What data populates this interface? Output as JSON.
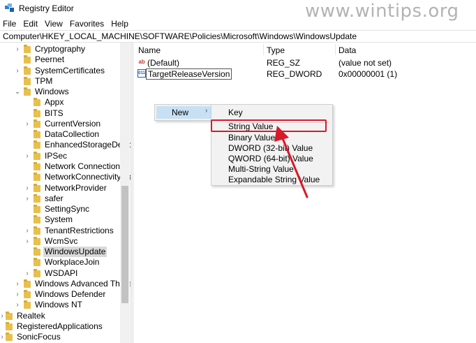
{
  "window": {
    "title": "Registry Editor"
  },
  "watermark": "www.wintips.org",
  "menu": [
    "File",
    "Edit",
    "View",
    "Favorites",
    "Help"
  ],
  "address": "Computer\\HKEY_LOCAL_MACHINE\\SOFTWARE\\Policies\\Microsoft\\Windows\\WindowsUpdate",
  "tree": [
    {
      "label": "Cryptography",
      "arrow": "›"
    },
    {
      "label": "Peernet",
      "arrow": ""
    },
    {
      "label": "SystemCertificates",
      "arrow": "›"
    },
    {
      "label": "TPM",
      "arrow": ""
    },
    {
      "label": "Windows",
      "arrow": "⌄"
    },
    {
      "label": "Appx",
      "arrow": ""
    },
    {
      "label": "BITS",
      "arrow": ""
    },
    {
      "label": "CurrentVersion",
      "arrow": "›"
    },
    {
      "label": "DataCollection",
      "arrow": ""
    },
    {
      "label": "EnhancedStorageDevic",
      "arrow": ""
    },
    {
      "label": "IPSec",
      "arrow": "›"
    },
    {
      "label": "Network Connections",
      "arrow": ""
    },
    {
      "label": "NetworkConnectivitySta",
      "arrow": ""
    },
    {
      "label": "NetworkProvider",
      "arrow": "›"
    },
    {
      "label": "safer",
      "arrow": "›"
    },
    {
      "label": "SettingSync",
      "arrow": ""
    },
    {
      "label": "System",
      "arrow": ""
    },
    {
      "label": "TenantRestrictions",
      "arrow": "›"
    },
    {
      "label": "WcmSvc",
      "arrow": "›"
    },
    {
      "label": "WindowsUpdate",
      "arrow": ""
    },
    {
      "label": "WorkplaceJoin",
      "arrow": ""
    },
    {
      "label": "WSDAPI",
      "arrow": "›"
    },
    {
      "label": "Windows Advanced Threa",
      "arrow": "›"
    },
    {
      "label": "Windows Defender",
      "arrow": "›"
    },
    {
      "label": "Windows NT",
      "arrow": "›"
    },
    {
      "label": "Realtek",
      "arrow": "›"
    },
    {
      "label": "RegisteredApplications",
      "arrow": ""
    },
    {
      "label": "SonicFocus",
      "arrow": "›"
    }
  ],
  "columns": {
    "name": "Name",
    "type": "Type",
    "data": "Data"
  },
  "values": [
    {
      "icon": "string-value-icon",
      "name": "(Default)",
      "type": "REG_SZ",
      "data": "(value not set)"
    },
    {
      "icon": "binary-value-icon",
      "name": "TargetReleaseVersion",
      "type": "REG_DWORD",
      "data": "0x00000001 (1)"
    }
  ],
  "context_menu": {
    "new_label": "New",
    "submenu_arrow": "›"
  },
  "new_submenu": [
    "Key",
    "String Value",
    "Binary Value",
    "DWORD (32-bit) Value",
    "QWORD (64-bit) Value",
    "Multi-String Value",
    "Expandable String Value"
  ],
  "colors": {
    "highlight_box": "#d9182a",
    "menu_hover": "#c7e0f4",
    "folder": "#e8c04e"
  }
}
